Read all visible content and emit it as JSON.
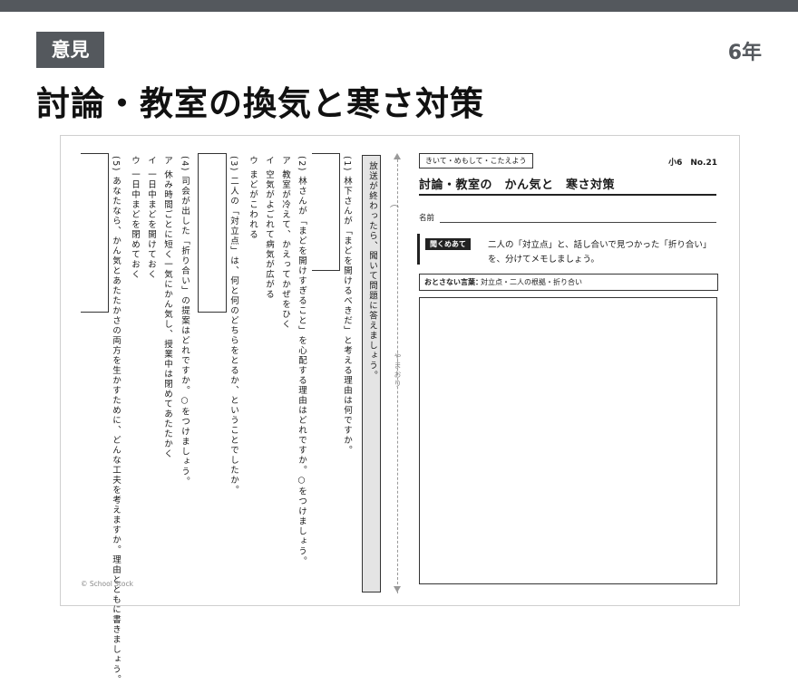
{
  "header": {
    "tag": "意見",
    "grade": "6年",
    "title": "討論・教室の換気と寒さ対策"
  },
  "left": {
    "instruction": "放送が終わったら、聞いて問題に答えましょう。",
    "q1": "(1) 林下さんが「まどを開けるべきだ」と考える理由は何ですか。",
    "q2": "(2) 林さんが「まどを開けすぎること」を心配する理由はどれですか。○をつけましょう。",
    "q2_a": "ア 教室が冷えて、かえってかぜをひく",
    "q2_b": "イ 空気がよごれて病気が広がる",
    "q2_c": "ウ まどがこわれる",
    "q3": "(3) 二人の「対立点」は、何と何のどちらをとるか、ということでしたか。",
    "q4": "(4) 司会が出した「折り合い」の提案はどれですか。○をつけましょう。",
    "q4_a": "ア 休み時間ごとに短く一気にかん気し、授業中は閉めてあたたかく",
    "q4_b": "イ 一日中まどを開けておく",
    "q4_c": "ウ 一日中まどを閉めておく",
    "q5": "(5) あなたなら、かん気とあたたかさの両方を生かすために、どんな工夫を考えますか。理由とともに書きましょう。",
    "fold": "やまおり",
    "copyright": "© School Stock"
  },
  "right": {
    "header_box": "きいて・めもして・こたえよう",
    "sheet_no": "小6　No.21",
    "title": "討論・教室の　かん気と　寒さ対策",
    "name_label": "名前",
    "q_label": "聞くめあて",
    "q_text": "二人の「対立点」と、話し合いで見つかった「折り合い」を、分けてメモしましょう。",
    "kw_label": "おとさない言葉：",
    "kw_text": "対立点・二人の根拠・折り合い"
  }
}
